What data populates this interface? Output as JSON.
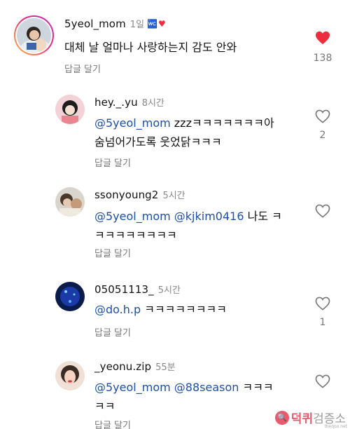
{
  "comments": [
    {
      "username": "5yeol_mom",
      "time": "1일",
      "badge": "🚾",
      "heart_badge": "♥",
      "text": "대체 날 얼마나 사랑하는지 감도 안와",
      "reply_label": "답글 달기",
      "likes": "138",
      "liked": true
    },
    {
      "username": "hey._.yu",
      "time": "8시간",
      "mention": "@5yeol_mom",
      "text_line1": " zzzㅋㅋㅋㅋㅋㅋㅋ아",
      "text_line2": "숨넘어가도록 웃었닭ㅋㅋㅋ",
      "reply_label": "답글 달기",
      "likes": "2"
    },
    {
      "username": "ssonyoung2",
      "time": "5시간",
      "mention": "@5yeol_mom",
      "mention2": "@kjkim0416",
      "text_line1": " 나도 ㅋ",
      "text_line2": "ㅋㅋㅋㅋㅋㅋㅋㅋ",
      "reply_label": "답글 달기"
    },
    {
      "username": "05051113_",
      "time": "5시간",
      "mention": "@do.h.p",
      "text_line1": " ㅋㅋㅋㅋㅋㅋㅋㅋ",
      "reply_label": "답글 달기",
      "likes": "1"
    },
    {
      "username": "_yeonu.zip",
      "time": "55분",
      "mention": "@5yeol_mom",
      "mention2": "@88season",
      "text_line1": " ㅋㅋㅋ",
      "text_line2": "ㅋㅋ",
      "reply_label": "답글 달기"
    }
  ],
  "watermark": {
    "brand_a": "덕퀴",
    "brand_b": "검증소",
    "url": "theqoo.net"
  },
  "colors": {
    "heart_liked": "#ed2d3e",
    "mention": "#1e4fa8",
    "secondary_text": "#777777"
  }
}
